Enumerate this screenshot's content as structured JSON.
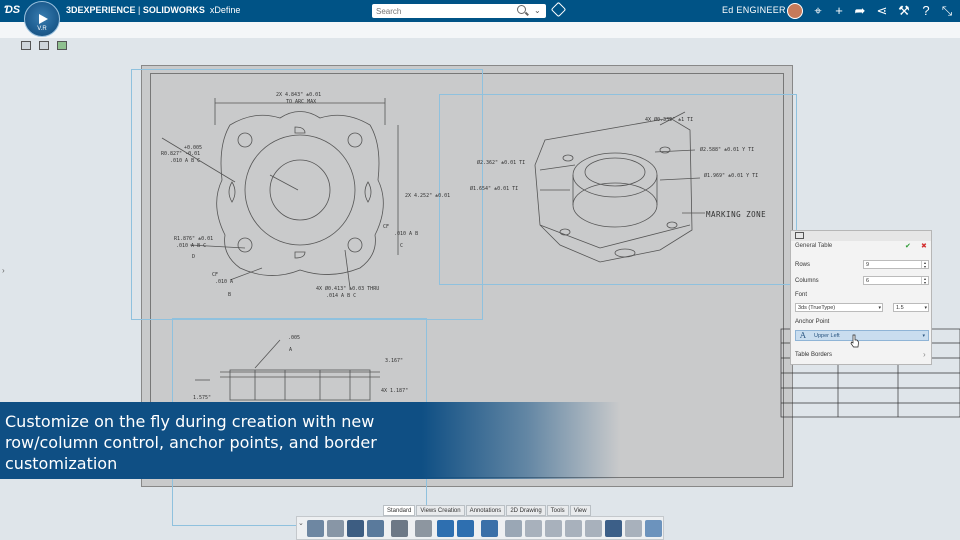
{
  "header": {
    "brand_prefix": "3DEXPERIENCE",
    "brand_app": "SOLIDWORKS",
    "brand_module": "xDefine",
    "compass_version": "V.R",
    "search_placeholder": "Search",
    "user_name": "Ed ENGINEER",
    "icons": [
      "tag-icon",
      "share-icon",
      "add-icon",
      "forward-icon",
      "network-icon",
      "tools-icon",
      "help-icon",
      "fullscreen-icon"
    ]
  },
  "drawing": {
    "marking_zone": "MARKING ZONE",
    "dims": {
      "top_dim": "2X 4.843\" ±0.01",
      "top_dim2": "TO ARC MAX",
      "r_dim": "R0.827\" -0.01",
      "r_dim_tol": "+0.005",
      "fcf1": ".010 A B C",
      "r1": "R1.876\" ±0.01",
      "fcf2": ".010 A B C",
      "cf1": "CF",
      "fcf3": ".010 A B",
      "cf2": "CF",
      "fcf4": ".010 A",
      "d_mid": "2X 4.252\" ±0.01",
      "holes": "4X Ø0.413\" ±0.03 THRU",
      "fcf5": ".014 A B C",
      "iso1": "Ø2.362\" ±0.01 TI",
      "iso2": "Ø2.588\" ±0.01 Y TI",
      "iso3": "Ø1.654\" ±0.01 TI",
      "iso4": "Ø1.969\" ±0.01 Y TI",
      "iso5": "4X Ø0.339\" ±1 TI",
      "sec1": ".005",
      "sec2": "3.167\"",
      "sec3": "4X 1.187\"",
      "sec4": "1.575\"",
      "datum_a": "A",
      "datum_b": "B",
      "datum_c": "C",
      "datum_d": "D"
    }
  },
  "panel": {
    "title": "General Table",
    "rows_label": "Rows",
    "rows_value": "9",
    "columns_label": "Columns",
    "columns_value": "6",
    "font_label": "Font",
    "font_value": "3ds (TrueType)",
    "font_size_value": "1.5",
    "anchor_label": "Anchor Point",
    "anchor_value": "Upper Left",
    "borders_label": "Table Borders"
  },
  "caption": "Customize on the fly during creation with new row/column control, anchor points, and border customization",
  "tabs": [
    {
      "label": "Standard",
      "active": true
    },
    {
      "label": "Views Creation",
      "active": false
    },
    {
      "label": "Annotations",
      "active": false
    },
    {
      "label": "2D Drawing",
      "active": false
    },
    {
      "label": "Tools",
      "active": false
    },
    {
      "label": "View",
      "active": false
    }
  ],
  "colors": {
    "header_bg": "#005386",
    "caption_bg": "#0f4f84",
    "selection": "#c9ddef"
  }
}
